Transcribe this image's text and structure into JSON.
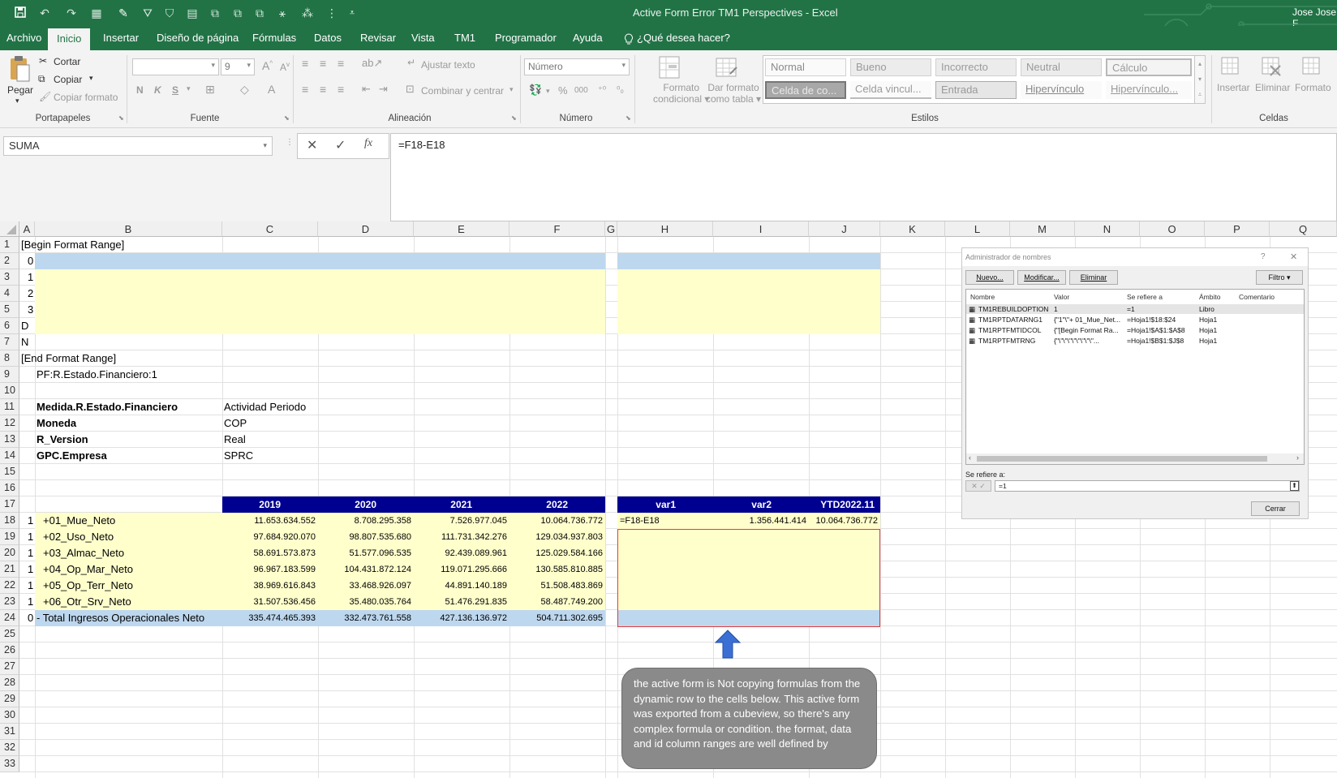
{
  "title_bar": {
    "title": "Active Form Error TM1 Perspectives  -  Excel",
    "user": "Jose Jose F"
  },
  "ribbon_tabs": [
    "Archivo",
    "Inicio",
    "Insertar",
    "Diseño de página",
    "Fórmulas",
    "Datos",
    "Revisar",
    "Vista",
    "TM1",
    "Programador",
    "Ayuda"
  ],
  "active_tab": "Inicio",
  "tell_me": "¿Qué desea hacer?",
  "clipboard": {
    "paste": "Pegar",
    "cut": "Cortar",
    "copy": "Copiar",
    "format_painter": "Copiar formato",
    "group": "Portapapeles"
  },
  "font": {
    "size": "9",
    "bold": "N",
    "italic": "K",
    "underline": "S",
    "group": "Fuente"
  },
  "alignment": {
    "wrap": "Ajustar texto",
    "merge": "Combinar y centrar",
    "group": "Alineación"
  },
  "number": {
    "format": "Número",
    "percent": "%",
    "thousands": "000",
    "group": "Número"
  },
  "styles": {
    "conditional": [
      "Formato",
      "condicional"
    ],
    "as_table": [
      "Dar formato",
      "como tabla"
    ],
    "group": "Estilos",
    "gallery": [
      [
        "Normal",
        "Bueno",
        "Incorrecto",
        "Neutral",
        "Cálculo"
      ],
      [
        "Celda de co...",
        "Celda vincul...",
        "Entrada",
        "Hipervínculo",
        "Hipervínculo..."
      ]
    ]
  },
  "cells_group": {
    "insert": "Insertar",
    "delete": "Eliminar",
    "format": "Formato",
    "group": "Celdas"
  },
  "formula_bar": {
    "name_box": "SUMA",
    "formula": "=F18-E18",
    "fx": "fx"
  },
  "columns": [
    "A",
    "B",
    "C",
    "D",
    "E",
    "F",
    "G",
    "H",
    "I",
    "J",
    "K",
    "L",
    "M",
    "N",
    "O",
    "P",
    "Q"
  ],
  "rows": [
    "1",
    "2",
    "3",
    "4",
    "5",
    "6",
    "7",
    "8",
    "9",
    "10",
    "11",
    "12",
    "13",
    "14",
    "15",
    "16",
    "17",
    "18",
    "19",
    "20",
    "21",
    "22",
    "23",
    "24",
    "25",
    "26",
    "27",
    "28",
    "29",
    "30",
    "31",
    "32",
    "33"
  ],
  "sheet": {
    "r1": "[Begin Format Range]",
    "a_col": {
      "r2": "0",
      "r3": "1",
      "r4": "2",
      "r5": "3",
      "r6": "D",
      "r7": "N"
    },
    "r8": "[End Format Range]",
    "r9": "PF:R.Estado.Financiero:1",
    "params": [
      {
        "label": "Medida.R.Estado.Financiero",
        "value": "Actividad Periodo"
      },
      {
        "label": "Moneda",
        "value": "COP"
      },
      {
        "label": "R_Version",
        "value": "Real"
      },
      {
        "label": "GPC.Empresa",
        "value": "SPRC"
      }
    ],
    "headers": [
      "2019",
      "2020",
      "2021",
      "2022",
      "var1",
      "var2",
      "YTD2022.11"
    ],
    "data_rows": [
      {
        "a": "1",
        "b": "+01_Mue_Neto",
        "c": "11.653.634.552",
        "d": "8.708.295.358",
        "e": "7.526.977.045",
        "f": "10.064.736.772",
        "h": "=F18-E18",
        "i": "1.356.441.414",
        "j": "10.064.736.772"
      },
      {
        "a": "1",
        "b": "+02_Uso_Neto",
        "c": "97.684.920.070",
        "d": "98.807.535.680",
        "e": "111.731.342.276",
        "f": "129.034.937.803",
        "h": "",
        "i": "",
        "j": ""
      },
      {
        "a": "1",
        "b": "+03_Almac_Neto",
        "c": "58.691.573.873",
        "d": "51.577.096.535",
        "e": "92.439.089.961",
        "f": "125.029.584.166",
        "h": "",
        "i": "",
        "j": ""
      },
      {
        "a": "1",
        "b": "+04_Op_Mar_Neto",
        "c": "96.967.183.599",
        "d": "104.431.872.124",
        "e": "119.071.295.666",
        "f": "130.585.810.885",
        "h": "",
        "i": "",
        "j": ""
      },
      {
        "a": "1",
        "b": "+05_Op_Terr_Neto",
        "c": "38.969.616.843",
        "d": "33.468.926.097",
        "e": "44.891.140.189",
        "f": "51.508.483.869",
        "h": "",
        "i": "",
        "j": ""
      },
      {
        "a": "1",
        "b": "+06_Otr_Srv_Neto",
        "c": "31.507.536.456",
        "d": "35.480.035.764",
        "e": "51.476.291.835",
        "f": "58.487.749.200",
        "h": "",
        "i": "",
        "j": ""
      }
    ],
    "total_row": {
      "a": "0",
      "b": "- Total Ingresos Operacionales Neto",
      "c": "335.474.465.393",
      "d": "332.473.761.558",
      "e": "427.136.136.972",
      "f": "504.711.302.695"
    }
  },
  "name_manager": {
    "title": "Administrador de nombres",
    "help": "?",
    "buttons": {
      "new": "Nuevo...",
      "edit": "Modificar...",
      "delete": "Eliminar",
      "filter": "Filtro ▾",
      "close": "Cerrar"
    },
    "columns": [
      "Nombre",
      "Valor",
      "Se refiere a",
      "Ámbito",
      "Comentario"
    ],
    "rows": [
      {
        "name": "TM1REBUILDOPTION",
        "value": "1",
        "ref": "=1",
        "scope": "Libro"
      },
      {
        "name": "TM1RPTDATARNG1",
        "value": "{\"1\"\\\"+ 01_Mue_Net...",
        "ref": "=Hoja1!$18:$24",
        "scope": "Hoja1"
      },
      {
        "name": "TM1RPTFMTIDCOL",
        "value": "{\"[Begin Format Ra...",
        "ref": "=Hoja1!$A$1:$A$8",
        "scope": "Hoja1"
      },
      {
        "name": "TM1RPTFMTRNG",
        "value": "{\"\\\"\\\"\\\"\\\"\\\"\\\"\\\"\\\"...",
        "ref": "=Hoja1!$B$1:$J$8",
        "scope": "Hoja1"
      }
    ],
    "refers_label": "Se refiere a:",
    "refers_value": "=1"
  },
  "annotation": "the active form is Not copying formulas from the dynamic row to the cells below. This active form was exported from a cubeview, so there's any complex formula or condition. the format, data and id column ranges are well defined by",
  "colors": {
    "excel_green": "#217346",
    "header_navy": "#000090",
    "light_blue": "#bdd7ee",
    "light_yellow": "#ffffcc",
    "red_border": "#e33b3b",
    "arrow_blue": "#3b6fd4"
  }
}
